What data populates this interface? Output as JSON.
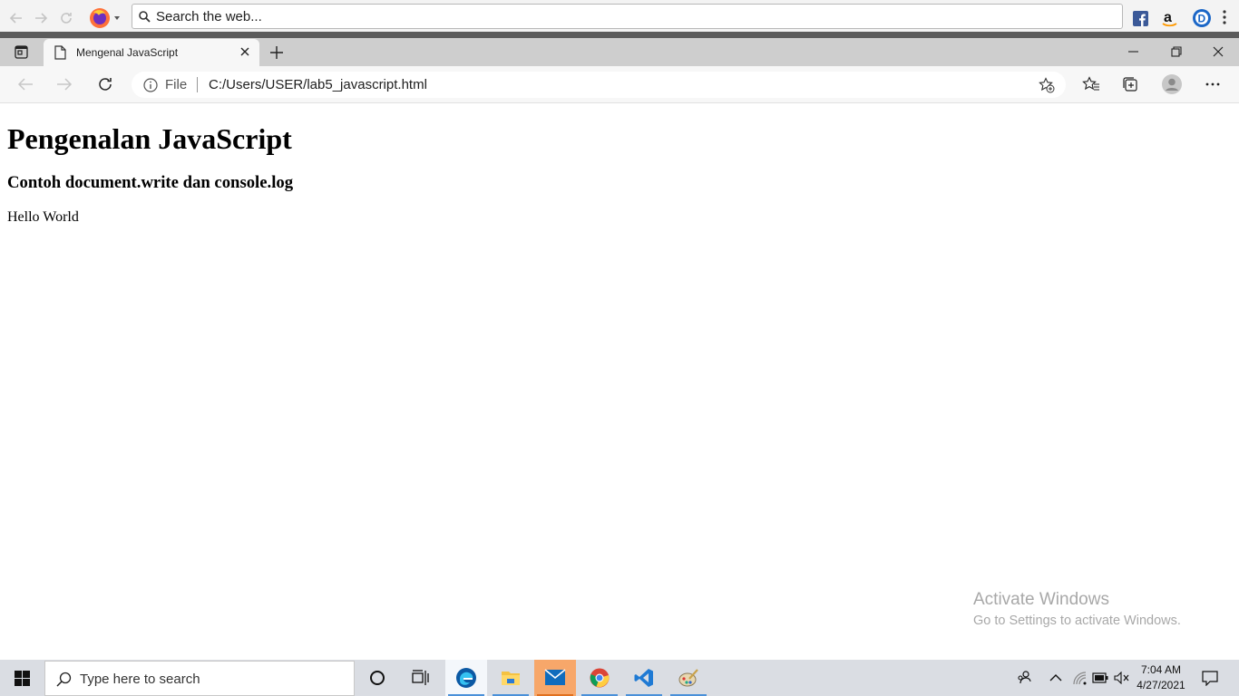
{
  "firefox_toolbar": {
    "search_placeholder": "Search the web..."
  },
  "tab": {
    "title": "Mengenal JavaScript"
  },
  "address_bar": {
    "scheme_label": "File",
    "url": "C:/Users/USER/lab5_javascript.html"
  },
  "page": {
    "heading": "Pengenalan JavaScript",
    "subheading": "Contoh document.write dan console.log",
    "output": "Hello World"
  },
  "watermark": {
    "title": "Activate Windows",
    "subtitle": "Go to Settings to activate Windows."
  },
  "taskbar": {
    "search_placeholder": "Type here to search",
    "time": "7:04 AM",
    "date": "4/27/2021"
  },
  "colors": {
    "edge_blue": "#0c59a4",
    "taskbar_bg": "#dadde3",
    "mail_active": "#f7a76a"
  },
  "icons": [
    "back-icon",
    "forward-icon",
    "reload-icon",
    "firefox-icon",
    "search-icon",
    "facebook-icon",
    "amazon-icon",
    "extension-d-icon",
    "kebab-icon",
    "tab-actions-icon",
    "page-icon",
    "close-icon",
    "new-tab-icon",
    "minimize-icon",
    "restore-icon",
    "info-icon",
    "add-favorite-icon",
    "favorites-icon",
    "collections-icon",
    "profile-icon",
    "more-icon",
    "windows-start-icon",
    "cortana-icon",
    "task-view-icon",
    "edge-icon",
    "file-explorer-icon",
    "mail-icon",
    "chrome-icon",
    "vscode-icon",
    "paint-icon",
    "people-icon",
    "chevron-up-icon",
    "wifi-icon",
    "battery-icon",
    "volume-muted-icon",
    "notification-icon"
  ]
}
